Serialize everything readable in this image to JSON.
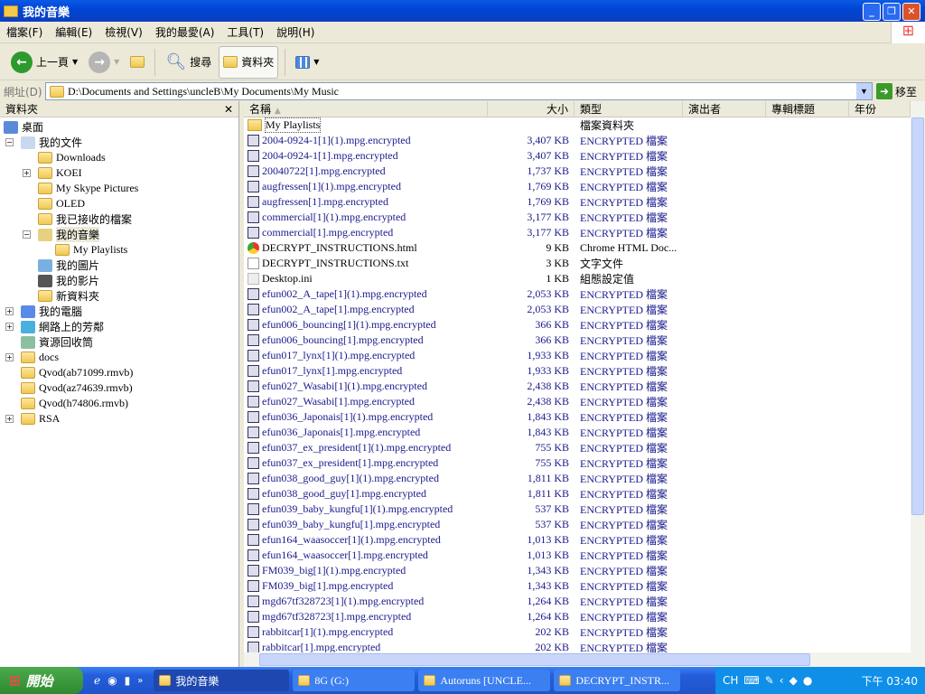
{
  "window": {
    "title": "我的音樂",
    "min": "_",
    "max": "❐",
    "close": "✕"
  },
  "menu": [
    "檔案(F)",
    "編輯(E)",
    "檢視(V)",
    "我的最愛(A)",
    "工具(T)",
    "說明(H)"
  ],
  "toolbar": {
    "back": "上一頁",
    "search": "搜尋",
    "folders": "資料夾"
  },
  "address": {
    "label": "網址(D)",
    "value": "D:\\Documents and Settings\\uncleB\\My Documents\\My Music",
    "go": "移至"
  },
  "tree": {
    "title": "資料夾",
    "close": "✕",
    "items": [
      {
        "label": "桌面",
        "level": 0,
        "toggle": "",
        "icon": "desktop"
      },
      {
        "label": "我的文件",
        "level": 1,
        "toggle": "-",
        "icon": "documents"
      },
      {
        "label": "Downloads",
        "level": 2,
        "toggle": "",
        "icon": "folder"
      },
      {
        "label": "KOEI",
        "level": 2,
        "toggle": "+",
        "icon": "folder"
      },
      {
        "label": "My Skype Pictures",
        "level": 2,
        "toggle": "",
        "icon": "folder"
      },
      {
        "label": "OLED",
        "level": 2,
        "toggle": "",
        "icon": "folder"
      },
      {
        "label": "我已接收的檔案",
        "level": 2,
        "toggle": "",
        "icon": "folder"
      },
      {
        "label": "我的音樂",
        "level": 2,
        "toggle": "-",
        "icon": "music",
        "selected": true
      },
      {
        "label": "My Playlists",
        "level": 3,
        "toggle": "",
        "icon": "folder"
      },
      {
        "label": "我的圖片",
        "level": 2,
        "toggle": "",
        "icon": "pictures"
      },
      {
        "label": "我的影片",
        "level": 2,
        "toggle": "",
        "icon": "videos"
      },
      {
        "label": "新資料夾",
        "level": 2,
        "toggle": "",
        "icon": "folder"
      },
      {
        "label": "我的電腦",
        "level": 1,
        "toggle": "+",
        "icon": "computer"
      },
      {
        "label": "網路上的芳鄰",
        "level": 1,
        "toggle": "+",
        "icon": "network"
      },
      {
        "label": "資源回收筒",
        "level": 1,
        "toggle": "",
        "icon": "recycle"
      },
      {
        "label": "docs",
        "level": 1,
        "toggle": "+",
        "icon": "folder"
      },
      {
        "label": "Qvod(ab71099.rmvb)",
        "level": 1,
        "toggle": "",
        "icon": "folder"
      },
      {
        "label": "Qvod(az74639.rmvb)",
        "level": 1,
        "toggle": "",
        "icon": "folder"
      },
      {
        "label": "Qvod(h74806.rmvb)",
        "level": 1,
        "toggle": "",
        "icon": "folder"
      },
      {
        "label": "RSA",
        "level": 1,
        "toggle": "+",
        "icon": "folder"
      }
    ]
  },
  "columns": [
    "名稱",
    "大小",
    "類型",
    "演出者",
    "專輯標題",
    "年份"
  ],
  "files": [
    {
      "name": "My Playlists",
      "size": "",
      "type": "檔案資料夾",
      "icon": "folder"
    },
    {
      "name": "2004-0924-1[1](1).mpg.encrypted",
      "size": "3,407 KB",
      "type": "ENCRYPTED 檔案",
      "icon": "enc"
    },
    {
      "name": "2004-0924-1[1].mpg.encrypted",
      "size": "3,407 KB",
      "type": "ENCRYPTED 檔案",
      "icon": "enc"
    },
    {
      "name": "20040722[1].mpg.encrypted",
      "size": "1,737 KB",
      "type": "ENCRYPTED 檔案",
      "icon": "enc"
    },
    {
      "name": "augfressen[1](1).mpg.encrypted",
      "size": "1,769 KB",
      "type": "ENCRYPTED 檔案",
      "icon": "enc"
    },
    {
      "name": "augfressen[1].mpg.encrypted",
      "size": "1,769 KB",
      "type": "ENCRYPTED 檔案",
      "icon": "enc"
    },
    {
      "name": "commercial[1](1).mpg.encrypted",
      "size": "3,177 KB",
      "type": "ENCRYPTED 檔案",
      "icon": "enc"
    },
    {
      "name": "commercial[1].mpg.encrypted",
      "size": "3,177 KB",
      "type": "ENCRYPTED 檔案",
      "icon": "enc"
    },
    {
      "name": "DECRYPT_INSTRUCTIONS.html",
      "size": "9 KB",
      "type": "Chrome HTML Doc...",
      "icon": "html"
    },
    {
      "name": "DECRYPT_INSTRUCTIONS.txt",
      "size": "3 KB",
      "type": "文字文件",
      "icon": "txt"
    },
    {
      "name": "Desktop.ini",
      "size": "1 KB",
      "type": "組態設定值",
      "icon": "ini"
    },
    {
      "name": "efun002_A_tape[1](1).mpg.encrypted",
      "size": "2,053 KB",
      "type": "ENCRYPTED 檔案",
      "icon": "enc"
    },
    {
      "name": "efun002_A_tape[1].mpg.encrypted",
      "size": "2,053 KB",
      "type": "ENCRYPTED 檔案",
      "icon": "enc"
    },
    {
      "name": "efun006_bouncing[1](1).mpg.encrypted",
      "size": "366 KB",
      "type": "ENCRYPTED 檔案",
      "icon": "enc"
    },
    {
      "name": "efun006_bouncing[1].mpg.encrypted",
      "size": "366 KB",
      "type": "ENCRYPTED 檔案",
      "icon": "enc"
    },
    {
      "name": "efun017_lynx[1](1).mpg.encrypted",
      "size": "1,933 KB",
      "type": "ENCRYPTED 檔案",
      "icon": "enc"
    },
    {
      "name": "efun017_lynx[1].mpg.encrypted",
      "size": "1,933 KB",
      "type": "ENCRYPTED 檔案",
      "icon": "enc"
    },
    {
      "name": "efun027_Wasabi[1](1).mpg.encrypted",
      "size": "2,438 KB",
      "type": "ENCRYPTED 檔案",
      "icon": "enc"
    },
    {
      "name": "efun027_Wasabi[1].mpg.encrypted",
      "size": "2,438 KB",
      "type": "ENCRYPTED 檔案",
      "icon": "enc"
    },
    {
      "name": "efun036_Japonais[1](1).mpg.encrypted",
      "size": "1,843 KB",
      "type": "ENCRYPTED 檔案",
      "icon": "enc"
    },
    {
      "name": "efun036_Japonais[1].mpg.encrypted",
      "size": "1,843 KB",
      "type": "ENCRYPTED 檔案",
      "icon": "enc"
    },
    {
      "name": "efun037_ex_president[1](1).mpg.encrypted",
      "size": "755 KB",
      "type": "ENCRYPTED 檔案",
      "icon": "enc"
    },
    {
      "name": "efun037_ex_president[1].mpg.encrypted",
      "size": "755 KB",
      "type": "ENCRYPTED 檔案",
      "icon": "enc"
    },
    {
      "name": "efun038_good_guy[1](1).mpg.encrypted",
      "size": "1,811 KB",
      "type": "ENCRYPTED 檔案",
      "icon": "enc"
    },
    {
      "name": "efun038_good_guy[1].mpg.encrypted",
      "size": "1,811 KB",
      "type": "ENCRYPTED 檔案",
      "icon": "enc"
    },
    {
      "name": "efun039_baby_kungfu[1](1).mpg.encrypted",
      "size": "537 KB",
      "type": "ENCRYPTED 檔案",
      "icon": "enc"
    },
    {
      "name": "efun039_baby_kungfu[1].mpg.encrypted",
      "size": "537 KB",
      "type": "ENCRYPTED 檔案",
      "icon": "enc"
    },
    {
      "name": "efun164_waasoccer[1](1).mpg.encrypted",
      "size": "1,013 KB",
      "type": "ENCRYPTED 檔案",
      "icon": "enc"
    },
    {
      "name": "efun164_waasoccer[1].mpg.encrypted",
      "size": "1,013 KB",
      "type": "ENCRYPTED 檔案",
      "icon": "enc"
    },
    {
      "name": "FM039_big[1](1).mpg.encrypted",
      "size": "1,343 KB",
      "type": "ENCRYPTED 檔案",
      "icon": "enc"
    },
    {
      "name": "FM039_big[1].mpg.encrypted",
      "size": "1,343 KB",
      "type": "ENCRYPTED 檔案",
      "icon": "enc"
    },
    {
      "name": "mgd67tf328723[1](1).mpg.encrypted",
      "size": "1,264 KB",
      "type": "ENCRYPTED 檔案",
      "icon": "enc"
    },
    {
      "name": "mgd67tf328723[1].mpg.encrypted",
      "size": "1,264 KB",
      "type": "ENCRYPTED 檔案",
      "icon": "enc"
    },
    {
      "name": "rabbitcar[1](1).mpg.encrypted",
      "size": "202 KB",
      "type": "ENCRYPTED 檔案",
      "icon": "enc"
    },
    {
      "name": "rabbitcar[1].mpg.encrypted",
      "size": "202 KB",
      "type": "ENCRYPTED 檔案",
      "icon": "enc"
    }
  ],
  "taskbar": {
    "start": "開始",
    "tasks": [
      {
        "label": "我的音樂",
        "active": true
      },
      {
        "label": "8G (G:)"
      },
      {
        "label": "Autoruns [UNCLE..."
      },
      {
        "label": "DECRYPT_INSTR..."
      }
    ],
    "lang": "CH",
    "clock": "下午 03:40"
  },
  "colors": {
    "encrypted_text": "#1a1a8c",
    "titlebar": "#0046d5",
    "taskbar": "#245edb"
  }
}
